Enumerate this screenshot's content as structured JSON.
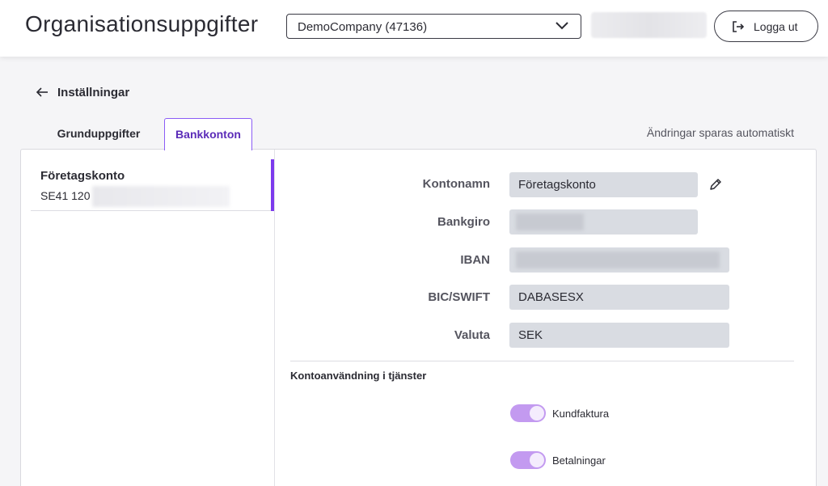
{
  "header": {
    "title": "Organisationsuppgifter",
    "company_select": {
      "value": "DemoCompany (47136)",
      "icon": "chevron-down-icon"
    },
    "logout": {
      "label": "Logga ut",
      "icon": "logout-icon"
    }
  },
  "nav": {
    "back_label": "Inställningar",
    "back_icon": "arrow-left-icon"
  },
  "tabs": [
    {
      "label": "Grunduppgifter",
      "active": false
    },
    {
      "label": "Bankkonton",
      "active": true
    }
  ],
  "autosave_note": "Ändringar sparas automatiskt",
  "accounts": [
    {
      "name": "Företagskonto",
      "number_visible": "SE41 120"
    }
  ],
  "fields": {
    "kontonamn": {
      "label": "Kontonamn",
      "value": "Företagskonto"
    },
    "bankgiro": {
      "label": "Bankgiro",
      "value": ""
    },
    "iban": {
      "label": "IBAN",
      "value": ""
    },
    "bic": {
      "label": "BIC/SWIFT",
      "value": "DABASESX"
    },
    "valuta": {
      "label": "Valuta",
      "value": "SEK"
    }
  },
  "usage": {
    "title": "Kontoanvändning i tjänster",
    "toggles": [
      {
        "label": "Kundfaktura",
        "on": true
      },
      {
        "label": "Betalningar",
        "on": true
      }
    ]
  },
  "colors": {
    "accent": "#7c3aed",
    "toggle_on": "#c39af0",
    "field_bg": "#d9dce2"
  }
}
